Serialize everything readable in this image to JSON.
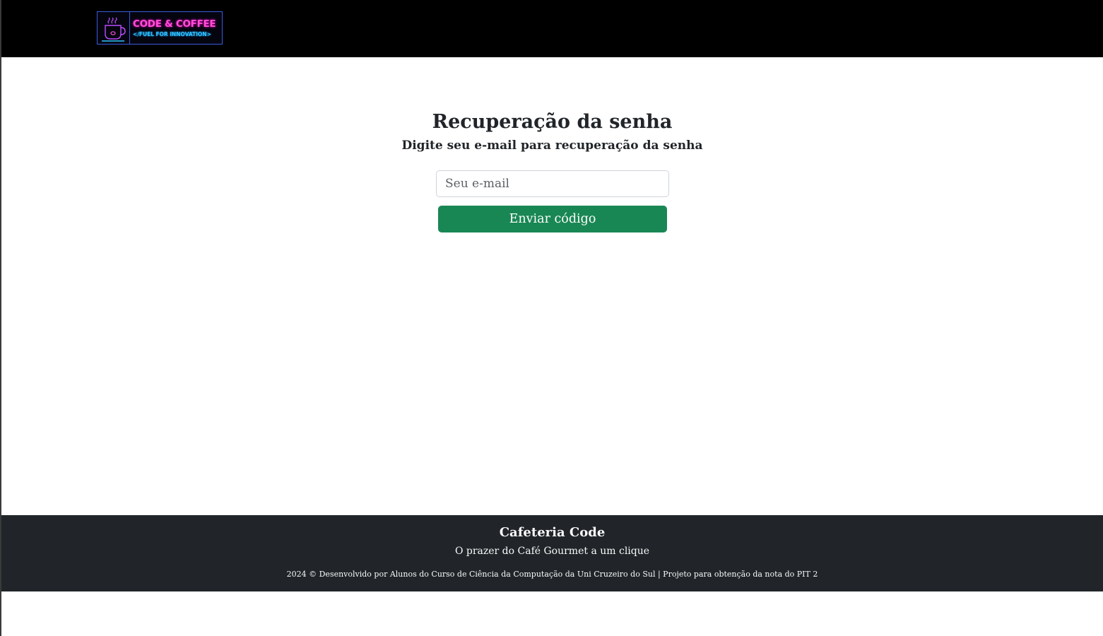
{
  "header": {
    "logo": {
      "title": "CODE & COFFEE",
      "tagline": "</FUEL FOR INNOVATION>",
      "icon": "coffee-cup-icon"
    }
  },
  "main": {
    "title": "Recuperação da senha",
    "subtitle": "Digite seu e-mail para recuperação da senha",
    "email_input": {
      "placeholder": "Seu e-mail",
      "value": ""
    },
    "submit_label": "Enviar código"
  },
  "footer": {
    "title": "Cafeteria Code",
    "tagline": "O prazer do Café Gourmet a um clique",
    "credits": "2024 © Desenvolvido por Alunos do Curso de Ciência da Computação da Uni Cruzeiro do Sul | Projeto para obtenção da nota do PIT 2"
  },
  "colors": {
    "navbar_bg": "#000000",
    "button_bg": "#198754",
    "footer_bg": "#212529",
    "logo_pink": "#ff4fd8",
    "logo_cyan": "#2ec5ff"
  }
}
